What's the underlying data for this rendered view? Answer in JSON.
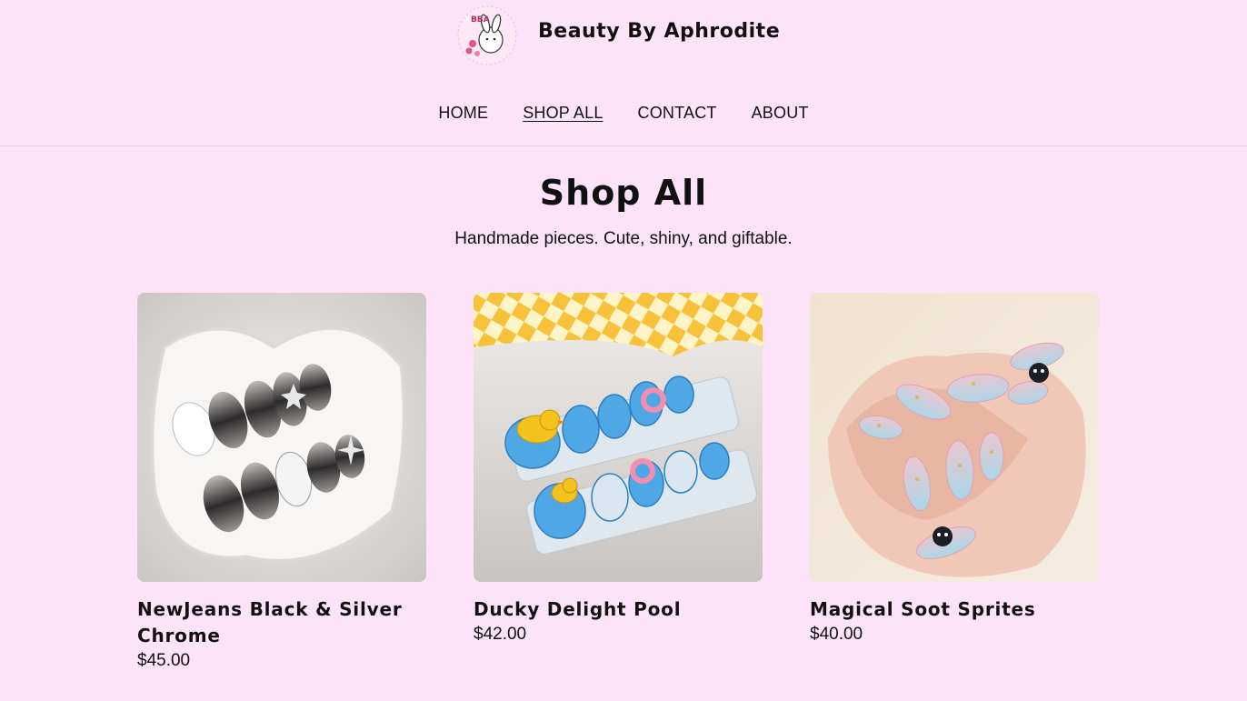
{
  "header": {
    "brand": "Beauty By Aphrodite",
    "logo_icon": "bunny-logo-icon"
  },
  "nav": {
    "items": [
      {
        "label": "HOME",
        "active": false
      },
      {
        "label": "SHOP ALL",
        "active": true
      },
      {
        "label": "CONTACT",
        "active": false
      },
      {
        "label": "ABOUT",
        "active": false
      }
    ]
  },
  "page": {
    "title": "Shop All",
    "subtitle": "Handmade pieces. Cute, shiny, and giftable."
  },
  "products": [
    {
      "name": "NewJeans Black & Silver Chrome",
      "price": "$45.00"
    },
    {
      "name": "Ducky Delight Pool",
      "price": "$42.00"
    },
    {
      "name": "Magical Soot Sprites",
      "price": "$40.00"
    }
  ],
  "colors": {
    "background": "#fce3f8",
    "text": "#111111"
  }
}
